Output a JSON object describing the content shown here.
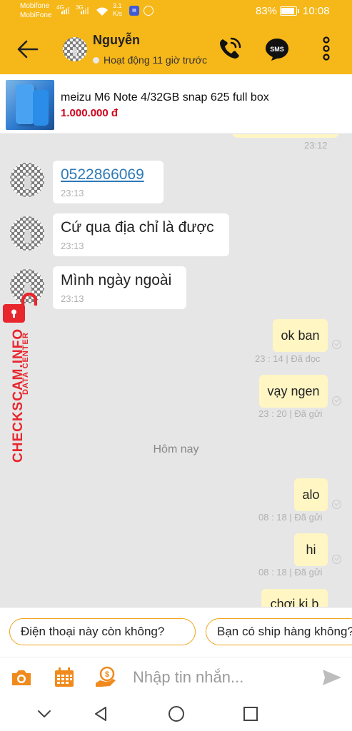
{
  "status_bar": {
    "carrier_1": "Mobifone",
    "carrier_2": "MobiFone",
    "signal_1_tag": "4G",
    "signal_2_tag": "3G",
    "speed_value": "3.1",
    "speed_unit": "K/s",
    "battery_pct": "83%",
    "battery_level": 0.83,
    "time": "10:08"
  },
  "header": {
    "contact_name": "Nguyễn",
    "presence": "Hoạt động 11 giờ trước",
    "sms_label": "SMS",
    "accent_color": "#f6b719"
  },
  "product": {
    "title": "meizu M6 Note 4/32GB snap 625 full box",
    "price": "1.000.000 đ"
  },
  "messages": {
    "prev_time": "23:12",
    "incoming": [
      {
        "text": "0522866069",
        "time": "23:13"
      },
      {
        "text": "Cứ qua địa chỉ là được",
        "time": "23:13"
      },
      {
        "text": "Mình ngày ngoài",
        "time": "23:13"
      }
    ],
    "outgoing": [
      {
        "text": "ok ban",
        "meta": "23 : 14  |  Đã đọc"
      },
      {
        "text": "vạy ngen",
        "meta": "23 : 20  |  Đã gửi"
      },
      {
        "text": "alo",
        "meta": "08 : 18  |  Đã gửi"
      },
      {
        "text": "hi",
        "meta": "08 : 18  |  Đã gửi"
      },
      {
        "text": "chơi ki b"
      }
    ],
    "date_separator": "Hôm nay"
  },
  "watermark": {
    "main": "CHECKSCAM.INFO",
    "sub": "DATA CENTER"
  },
  "quick_replies": [
    "Điện thoại này còn không?",
    "Bạn có ship hàng không?"
  ],
  "input": {
    "placeholder": "Nhập tin nhắn..."
  }
}
